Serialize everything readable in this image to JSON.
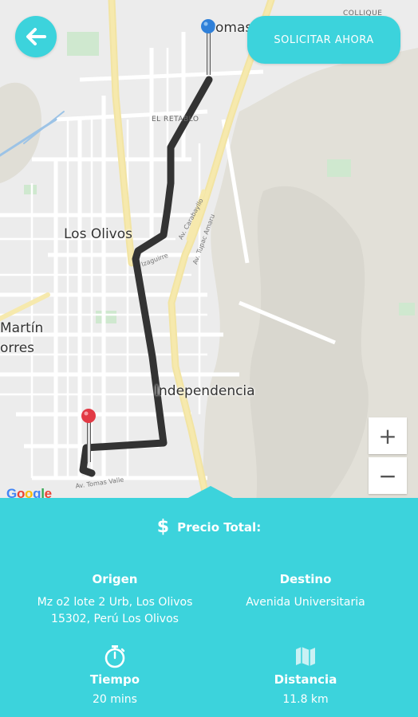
{
  "actions": {
    "request_label": "SOLICITAR AHORA"
  },
  "map": {
    "places": {
      "los_olivos": "Los Olivos",
      "independencia": "Independencia",
      "el_retablo": "EL RETABLO",
      "martin_line1": "Martín",
      "martin_line2": "orres",
      "tomas": "omas",
      "collique": "COLLIQUE"
    },
    "streets": {
      "av_carabayllo": "Av. Carabayllo",
      "av_tupac_amaru": "Av. Tupac Amaru",
      "av_tomas_valle": "Av. Tomas Valle",
      "av_izaguirre": "Izaguirre"
    },
    "zoom_in": "+",
    "zoom_out": "−",
    "attribution": "Google"
  },
  "summary": {
    "price_icon": "$",
    "price_label": "Precio Total:",
    "origin_label": "Origen",
    "origin_value_line1": "Mz o2 lote 2 Urb, Los Olivos",
    "origin_value_line2": "15302, Perú Los Olivos",
    "destination_label": "Destino",
    "destination_value": "Avenida Universitaria",
    "time_label": "Tiempo",
    "time_value": "20 mins",
    "distance_label": "Distancia",
    "distance_value": "11.8 km"
  },
  "colors": {
    "accent": "#3cd3dc",
    "route": "#333333",
    "origin_pin": "#e23a45",
    "destination_pin": "#2f80d9"
  }
}
